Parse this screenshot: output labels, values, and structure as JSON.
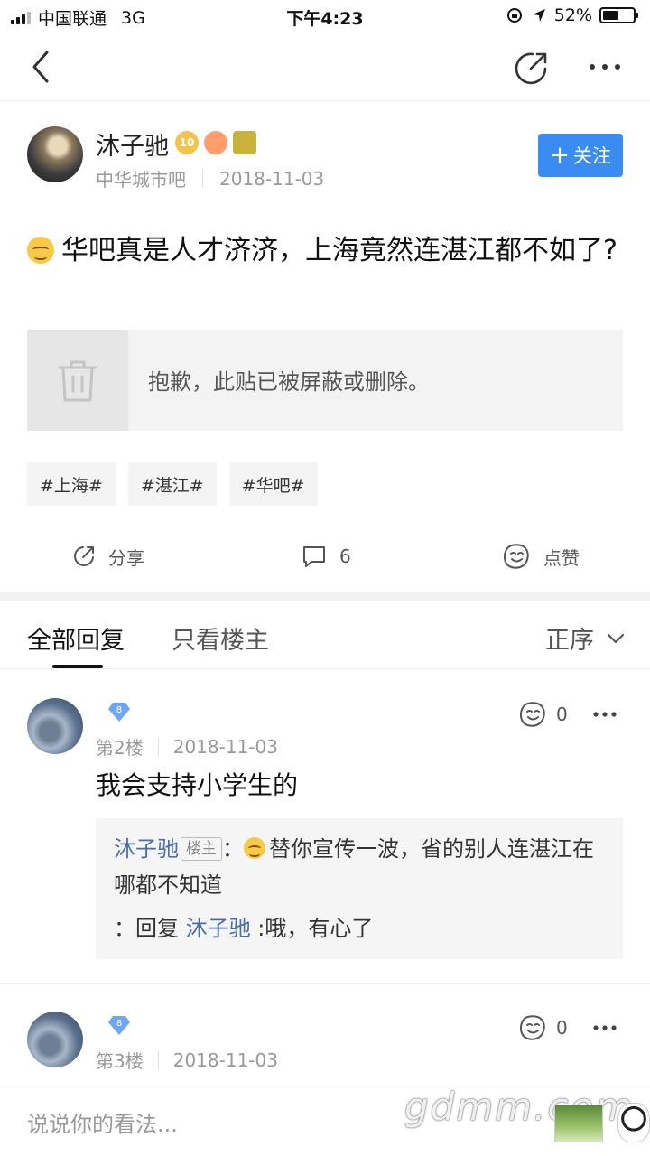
{
  "status_bar": {
    "carrier": "中国联通",
    "network": "3G",
    "time": "下午4:23",
    "battery": "52%",
    "battery_level": 0.52
  },
  "post": {
    "author": "沐子驰",
    "level_badge": "10",
    "forum": "中华城市吧",
    "date": "2018-11-03",
    "follow_label": "关注",
    "title": "华吧真是人才济济，上海竟然连湛江都不如了?",
    "blocked_message": "抱歉，此贴已被屏蔽或删除。",
    "tags": [
      "#上海#",
      "#湛江#",
      "#华吧#"
    ],
    "actions": {
      "share_label": "分享",
      "comment_count": "6",
      "like_label": "点赞"
    }
  },
  "tabs": {
    "all_replies": "全部回复",
    "owner_only": "只看楼主",
    "sort_label": "正序"
  },
  "replies": [
    {
      "level": "8",
      "floor": "第2楼",
      "date": "2018-11-03",
      "likes": "0",
      "content": "我会支持小学生的",
      "quote": {
        "name": "沐子驰",
        "owner_tag": "楼主",
        "colon": "：",
        "text": "替你宣传一波，省的别人连湛江在哪都不知道",
        "sub_prefix": "：回复",
        "sub_name": "沐子驰",
        "sub_text": ":哦，有心了"
      }
    },
    {
      "level": "8",
      "floor": "第3楼",
      "date": "2018-11-03",
      "likes": "0"
    }
  ],
  "bottom_bar": {
    "placeholder": "说说你的看法...",
    "watermark": "gdmm.com"
  },
  "icons": {
    "back": "chevron-left-icon",
    "share_top": "share-arrow-icon",
    "more": "more-dots-icon",
    "trash": "trash-icon",
    "comment": "comment-bubble-icon",
    "like": "thumb-face-icon",
    "diamond": "diamond-icon",
    "dropdown": "chevron-down-icon"
  },
  "colors": {
    "accent": "#3b8cf0",
    "link": "#4a6ea9"
  }
}
